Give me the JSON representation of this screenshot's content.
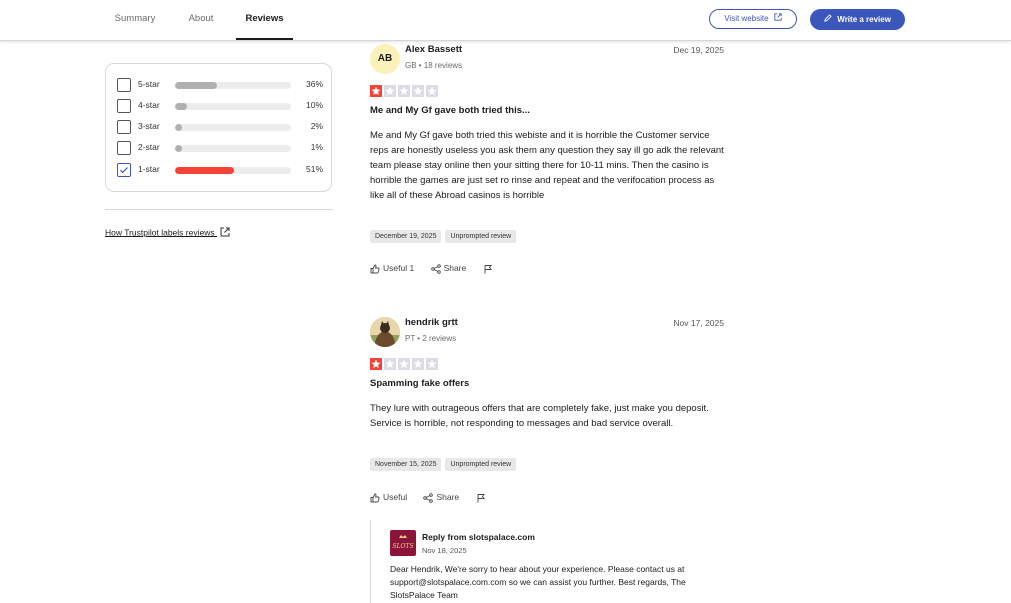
{
  "tabs": [
    {
      "label": "Summary"
    },
    {
      "label": "About"
    },
    {
      "label": "Reviews"
    }
  ],
  "header": {
    "visit_label": "Visit website",
    "write_label": "Write a review",
    "accent_color": "#3c57bc"
  },
  "filters": [
    {
      "label": "5-star",
      "percent_text": "36%",
      "percent": 36,
      "checked": false
    },
    {
      "label": "4-star",
      "percent_text": "10%",
      "percent": 10,
      "checked": false
    },
    {
      "label": "3-star",
      "percent_text": "2%",
      "percent": 2,
      "checked": false
    },
    {
      "label": "2-star",
      "percent_text": "1%",
      "percent": 1,
      "checked": false
    },
    {
      "label": "1-star",
      "percent_text": "51%",
      "percent": 51,
      "checked": true
    }
  ],
  "labels_link": "How Trustpilot labels reviews",
  "reviews": [
    {
      "avatar_initials": "AB",
      "name": "Alex Bassett",
      "meta": "GB • 18 reviews",
      "date": "Dec 19, 2025",
      "rating": 1,
      "title": "Me and My Gf gave both tried this...",
      "body": "Me and My Gf gave both tried this webiste and it is horrible the Customer service reps are honestly useless you ask them any question they say ill go adk the relevant team please stay online then your sitting there for 10-11 mins. Then the casino is horrible the games are just set ro rinse and repeat and the verifocation process as like all of these Abroad casinos is horrible",
      "experience_date": "December 19, 2025",
      "tag": "Unprompted review",
      "useful_label": "Useful 1",
      "share_label": "Share"
    },
    {
      "avatar_initials": "",
      "name": "hendrik grtt",
      "meta": "PT • 2 reviews",
      "date": "Nov 17, 2025",
      "rating": 1,
      "title": "Spamming fake offers",
      "body": "They lure with outrageous offers that are completely fake, just make you deposit. Service is horrible, not responding to messages and bad service overall.",
      "experience_date": "November 15, 2025",
      "tag": "Unprompted review",
      "useful_label": "Useful",
      "share_label": "Share"
    }
  ],
  "reply": {
    "logo_text": "SLOTS",
    "title": "Reply from slotspalace.com",
    "date": "Nov 18, 2025",
    "body": "Dear Hendrik, We're sorry to hear about your experience. Please contact us at support@slotspalace.com.com so we can assist you further. Best regards, The SlotsPalace Team"
  }
}
